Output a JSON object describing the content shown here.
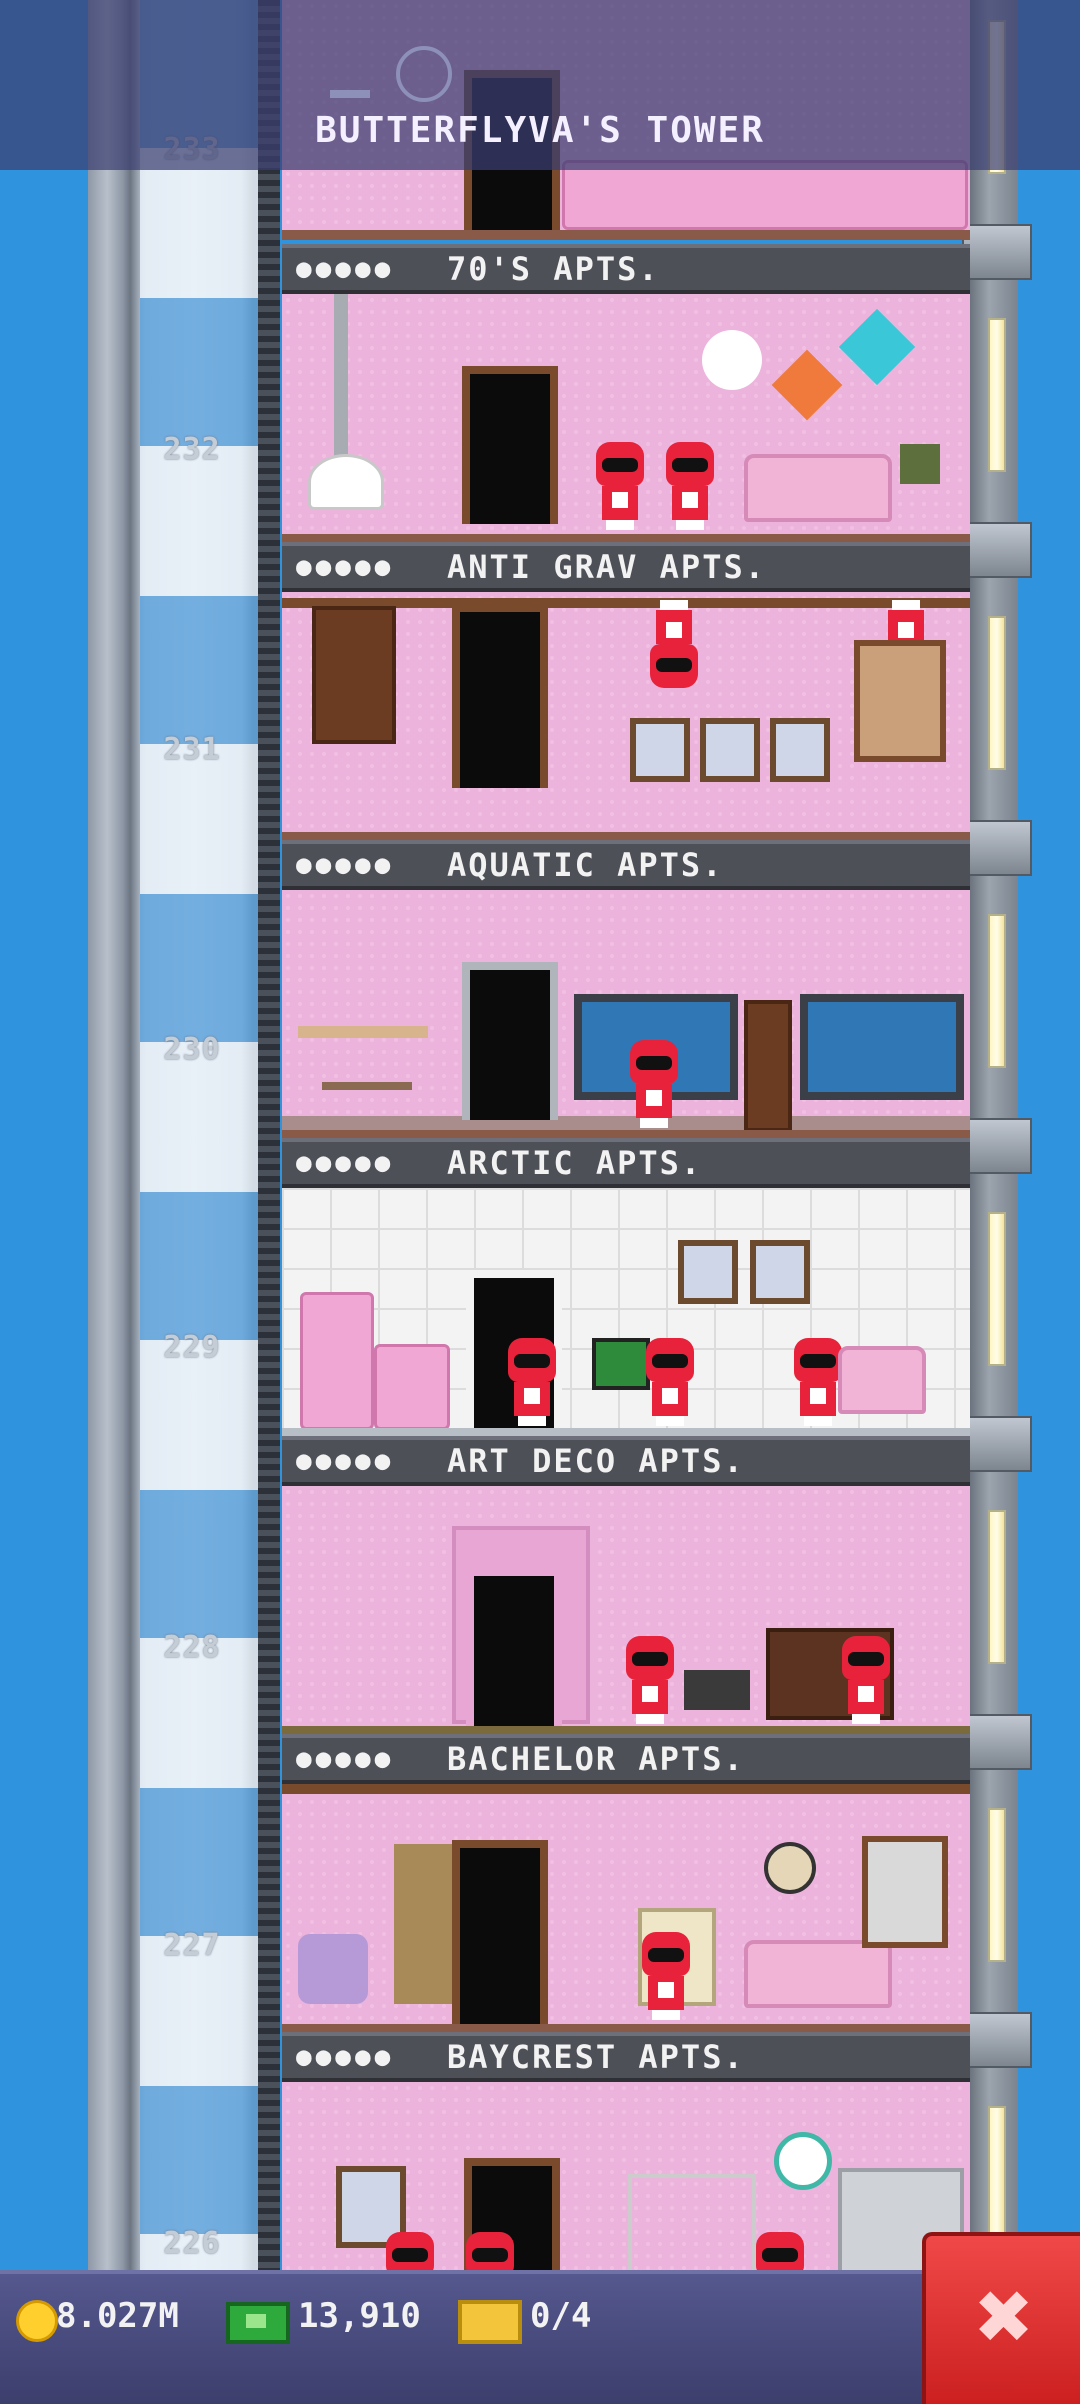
{
  "header": {
    "title": "BUTTERFLYVA'S TOWER"
  },
  "floors": [
    {
      "number": "233",
      "name": ""
    },
    {
      "number": "232",
      "name": "70'S APTS."
    },
    {
      "number": "231",
      "name": "ANTI GRAV APTS."
    },
    {
      "number": "230",
      "name": "AQUATIC APTS."
    },
    {
      "number": "229",
      "name": "ARCTIC APTS."
    },
    {
      "number": "228",
      "name": "ART DECO APTS."
    },
    {
      "number": "227",
      "name": "BACHELOR APTS."
    },
    {
      "number": "226",
      "name": "BAYCREST APTS."
    }
  ],
  "resident_dots": "●●●●●",
  "status_bar": {
    "coins": "8.027M",
    "bux": "13,910",
    "tickets": "0/4"
  },
  "icons": {
    "coin": "coin-icon",
    "bux": "cash-icon",
    "ticket": "ticket-icon",
    "close": "close-icon"
  },
  "colors": {
    "sky": "#2f93dd",
    "room_pink": "#ecb4dc",
    "banner": "#4e5058",
    "close_red": "#e03232",
    "bar": "#4a4c7e"
  }
}
